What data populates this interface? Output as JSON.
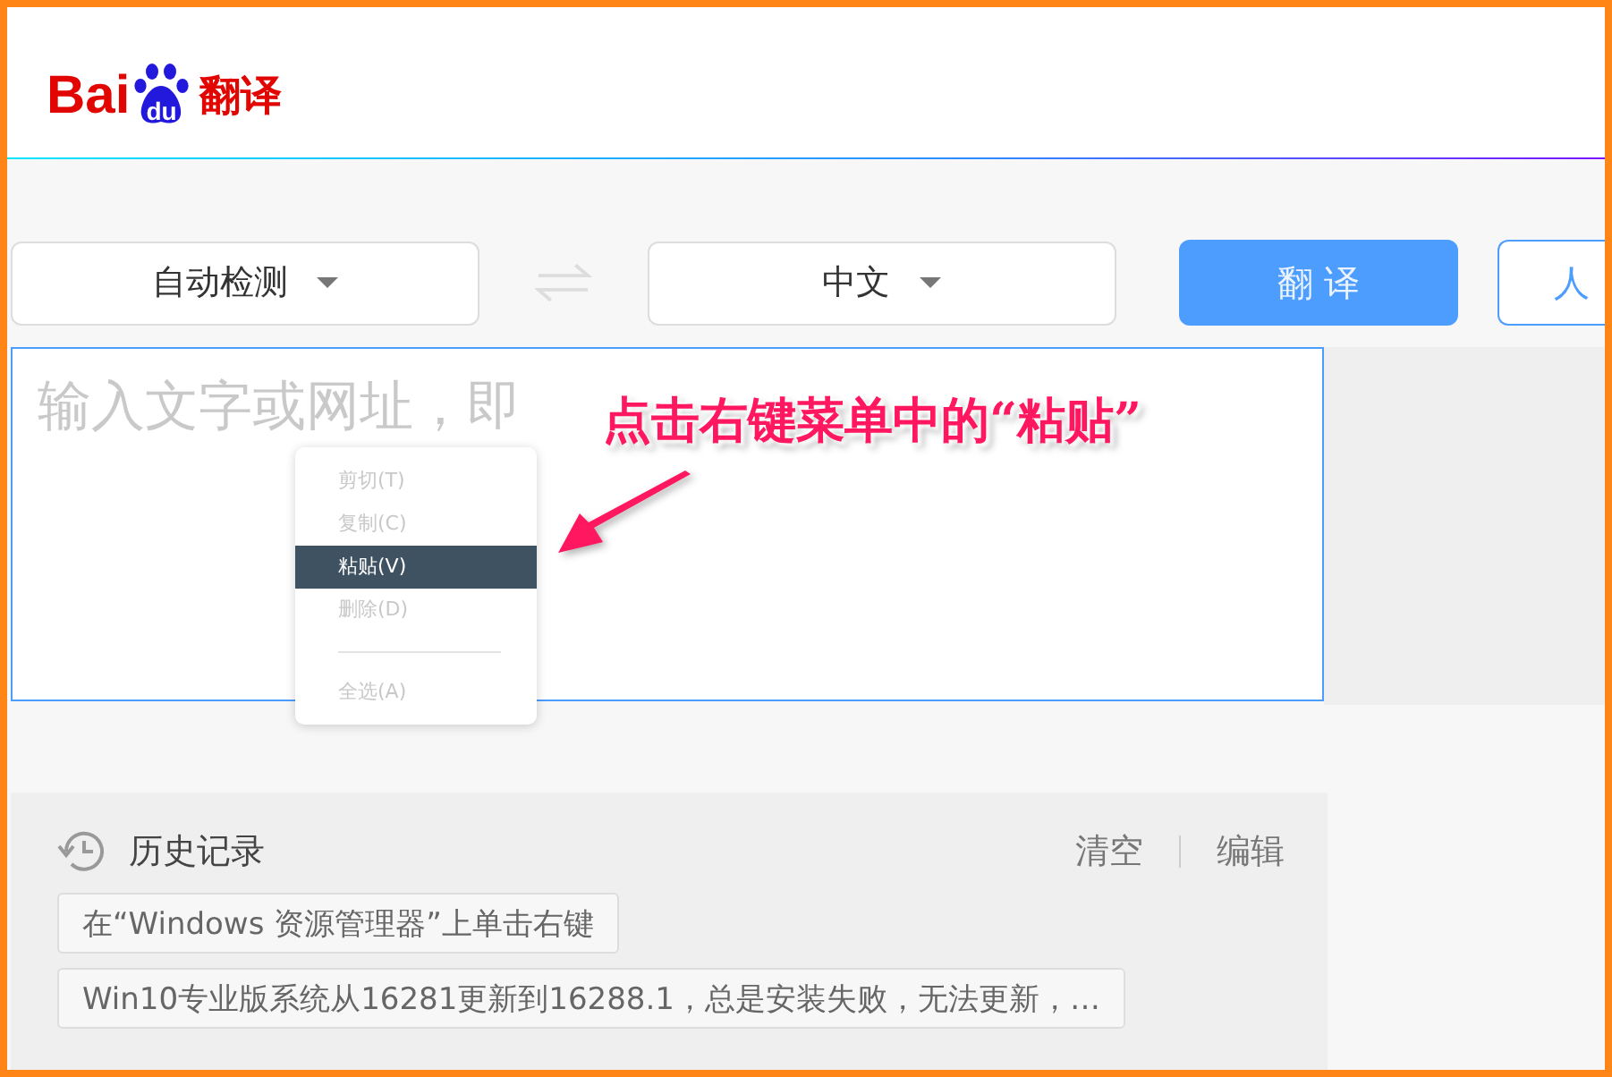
{
  "logo": {
    "word": "Bai",
    "paw_text": "du",
    "product": "翻译"
  },
  "toolbar": {
    "source_language": "自动检测",
    "target_language": "中文",
    "translate_button": "翻 译",
    "human_button": "人"
  },
  "input": {
    "placeholder": "输入文字或网址，即"
  },
  "context_menu": [
    {
      "kind": "item",
      "label": "剪切(T)",
      "disabled": true,
      "selected": false
    },
    {
      "kind": "item",
      "label": "复制(C)",
      "disabled": true,
      "selected": false
    },
    {
      "kind": "item",
      "label": "粘贴(V)",
      "disabled": false,
      "selected": true
    },
    {
      "kind": "item",
      "label": "删除(D)",
      "disabled": true,
      "selected": false
    },
    {
      "kind": "separator"
    },
    {
      "kind": "item",
      "label": "全选(A)",
      "disabled": true,
      "selected": false
    }
  ],
  "annotation": {
    "text": "点击右键菜单中的“粘贴”"
  },
  "history": {
    "title": "历史记录",
    "clear": "清空",
    "edit": "编辑",
    "items": [
      "在“Windows 资源管理器”上单击右键",
      "Win10专业版系统从16281更新到16288.1，总是安装失败，无法更新，…"
    ]
  }
}
